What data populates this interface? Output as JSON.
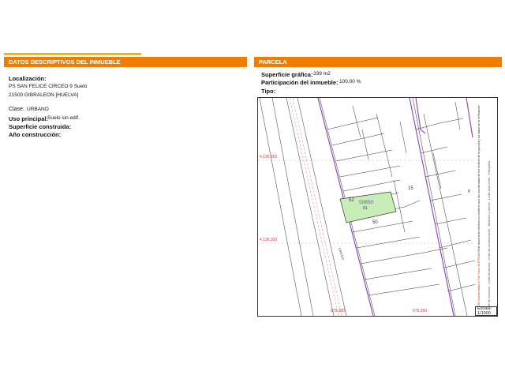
{
  "left_panel": {
    "header": "DATOS DESCRIPTIVOS DEL INMUEBLE",
    "localizacion_label": "Localización:",
    "address_line1": "PS SAN FELICE CIRCEO 9 Suelo",
    "address_line2": "21500 GIBRALEON [HUELVA]",
    "clase_label": "Clase:",
    "clase_value": "URBANO",
    "uso_label": "Uso principal:",
    "uso_value": "Suelo sin edif.",
    "superficie_construida_label": "Superficie construida:",
    "ano_label": "Año construcción:"
  },
  "right_panel": {
    "header": "PARCELA",
    "superficie_grafica_label": "Superficie gráfica:",
    "superficie_grafica_value": "339 m2",
    "participacion_label": "Participación del inmueble:",
    "participacion_value": "100,00 %",
    "tipo_label": "Tipo:"
  },
  "map": {
    "coord_y_top": "4.136.350",
    "coord_y_bottom": "4.136.300",
    "coord_x_left": "679.300",
    "coord_x_right": "679.350",
    "parcel_ref": "50850",
    "parcel_sub": "01",
    "label_52": "52",
    "label_50": "50",
    "label_15": "15",
    "label_p": "P",
    "street_label": "CIRCEO",
    "highlight_color": "#c8eeb8",
    "boundary_color": "#8b3fc2",
    "coord_color": "#d04040"
  },
  "legend": {
    "text_red": "ETRS89 Coordenadas U.T.M. Huso 30 ETRS89",
    "text_main": "Este documento electrónico contiene solo las coordenadas de los vértices de la parcela y los datos de la verificación",
    "items": [
      "Límite de manzana",
      "Límite de parcela",
      "Límite de construcciones",
      "Mobiliario y aceras",
      "Límite zona verde",
      "Hidrografía"
    ]
  },
  "scale": {
    "label": "Escala:",
    "value": "1/1000"
  }
}
